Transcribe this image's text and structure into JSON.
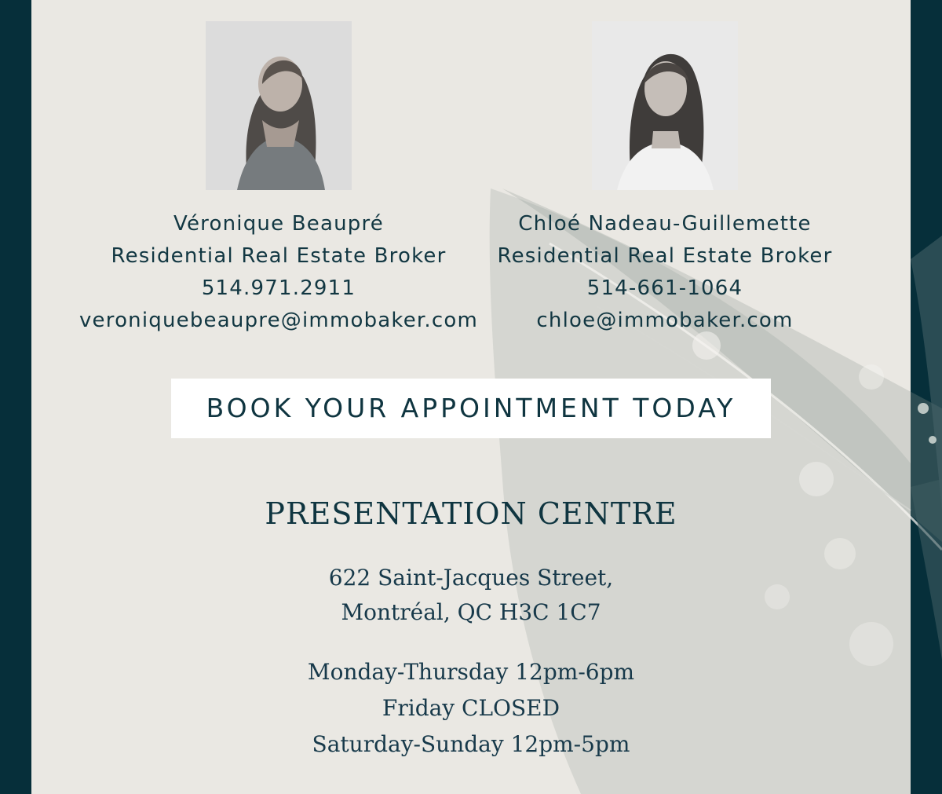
{
  "colors": {
    "frame": "#062f3a",
    "panel": "#eae8e3",
    "text": "#0f3540",
    "button_bg": "#ffffff"
  },
  "agents": [
    {
      "name": "Véronique Beaupré",
      "role": "Residential Real Estate Broker",
      "phone": "514.971.2911",
      "email": "veroniquebeaupre@immobaker.com"
    },
    {
      "name": "Chloé Nadeau-Guillemette",
      "role": "Residential Real Estate Broker",
      "phone": "514-661-1064",
      "email": "chloe@immobaker.com"
    }
  ],
  "cta": {
    "label": "BOOK YOUR APPOINTMENT TODAY"
  },
  "presentation_centre": {
    "title": "PRESENTATION CENTRE",
    "address_line1": "622 Saint-Jacques Street,",
    "address_line2": "Montréal, QC H3C 1C7",
    "hours": [
      "Monday-Thursday 12pm-6pm",
      "Friday CLOSED",
      "Saturday-Sunday 12pm-5pm"
    ]
  }
}
